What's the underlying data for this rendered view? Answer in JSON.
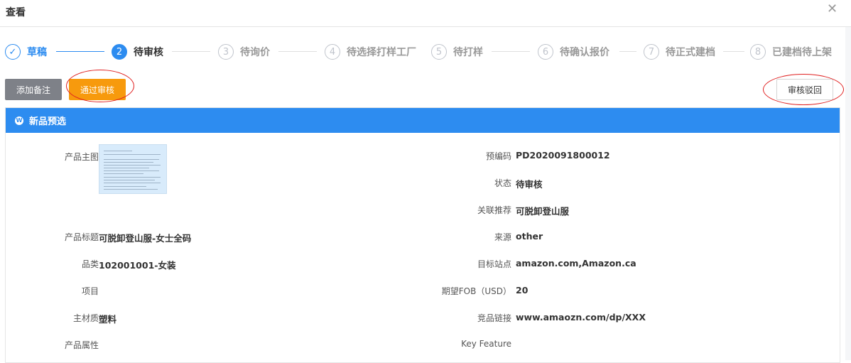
{
  "dialog": {
    "title": "查看",
    "close_icon": "close-icon"
  },
  "steps": [
    {
      "number": "1",
      "label": "草稿",
      "status": "done"
    },
    {
      "number": "2",
      "label": "待审核",
      "status": "active"
    },
    {
      "number": "3",
      "label": "待询价",
      "status": "pending"
    },
    {
      "number": "4",
      "label": "待选择打样工厂",
      "status": "pending"
    },
    {
      "number": "5",
      "label": "待打样",
      "status": "pending"
    },
    {
      "number": "6",
      "label": "待确认报价",
      "status": "pending"
    },
    {
      "number": "7",
      "label": "待正式建档",
      "status": "pending"
    },
    {
      "number": "8",
      "label": "已建档待上架",
      "status": "pending"
    }
  ],
  "toolbar": {
    "add_note_label": "添加备注",
    "approve_label": "通过审核",
    "reject_label": "审核驳回"
  },
  "panel": {
    "title": "新品预选",
    "header_color": "#2d8cf0",
    "left": {
      "main_image_label": "产品主图",
      "product_title_label": "产品标题",
      "product_title_value": "可脱卸登山服-女士全码",
      "category_label": "品类",
      "category_value": "102001001-女装",
      "project_label": "项目",
      "project_value": "",
      "material_label": "主材质",
      "material_value": "塑料",
      "attributes_label": "产品属性"
    },
    "right": {
      "precode_label": "预编码",
      "precode_value": "PD2020091800012",
      "status_label": "状态",
      "status_value": "待审核",
      "related_label": "关联推荐",
      "related_value": "可脱卸登山服",
      "source_label": "来源",
      "source_value": "other",
      "target_site_label": "目标站点",
      "target_site_value": "amazon.com,Amazon.ca",
      "fob_label": "期望FOB（USD）",
      "fob_value": "20",
      "competitor_label": "竞品链接",
      "competitor_value": "www.amaozn.com/dp/XXX",
      "key_feature_label": "Key Feature"
    }
  },
  "colors": {
    "primary": "#2d8cf0",
    "approve": "#f79a0d",
    "note": "#7e8188",
    "annotation": "#e02020"
  }
}
